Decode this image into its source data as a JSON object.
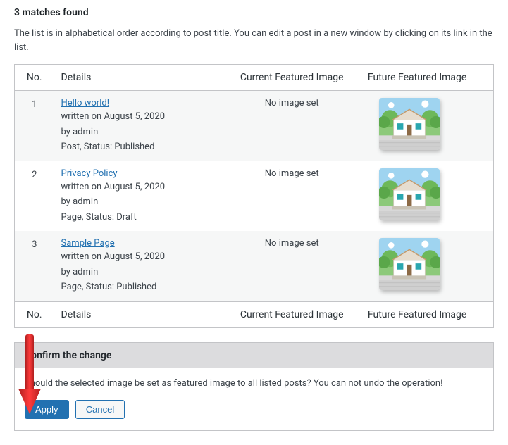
{
  "matches": {
    "heading": "3 matches found",
    "description": "The list is in alphabetical order according to post title. You can edit a post in a new window by clicking on its link in the list."
  },
  "columns": {
    "no": "No.",
    "details": "Details",
    "current": "Current Featured Image",
    "future": "Future Featured Image"
  },
  "rows": [
    {
      "no": "1",
      "title": "Hello world!",
      "date_line": "written on August 5, 2020",
      "by_line": "by admin",
      "type_line": "Post, Status: Published",
      "current": "No image set"
    },
    {
      "no": "2",
      "title": "Privacy Policy",
      "date_line": "written on August 5, 2020",
      "by_line": "by admin",
      "type_line": "Page, Status: Draft",
      "current": "No image set"
    },
    {
      "no": "3",
      "title": "Sample Page",
      "date_line": "written on August 5, 2020",
      "by_line": "by admin",
      "type_line": "Page, Status: Published",
      "current": "No image set"
    }
  ],
  "confirm": {
    "heading": "Confirm the change",
    "text": "Should the selected image be set as featured image to all listed posts? You can not undo the operation!",
    "apply": "Apply",
    "cancel": "Cancel"
  },
  "thumbnail_semantic": "house-thumbnail"
}
